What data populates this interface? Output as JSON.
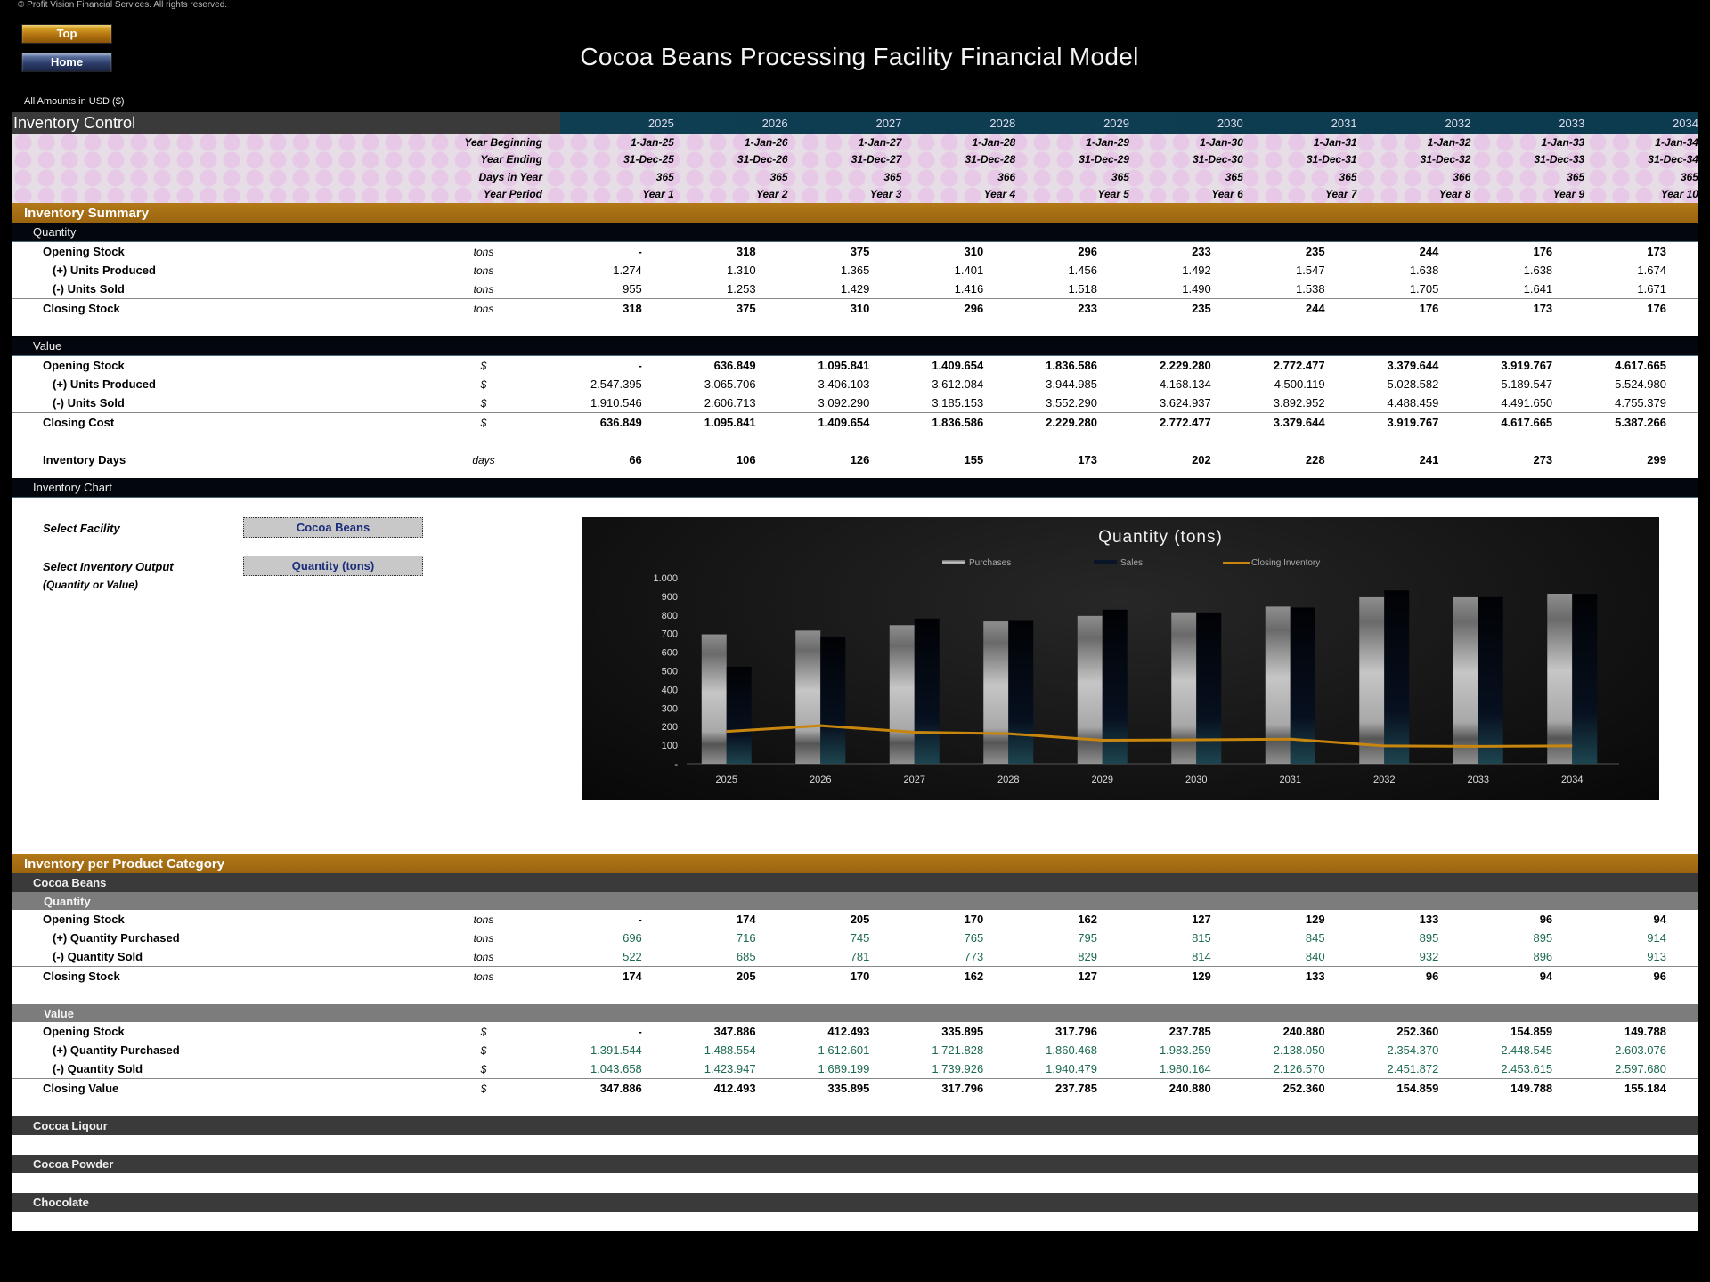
{
  "copyright": "© Profit Vision Financial Services. All rights reserved.",
  "nav": {
    "top_label": "Top",
    "home_label": "Home"
  },
  "title": "Cocoa Beans Processing Facility Financial Model",
  "amounts_note": "All Amounts in  USD ($)",
  "header": {
    "title": "Inventory Control",
    "years": [
      "2025",
      "2026",
      "2027",
      "2028",
      "2029",
      "2030",
      "2031",
      "2032",
      "2033",
      "2034"
    ],
    "rows": [
      {
        "label": "Year Beginning",
        "values": [
          "1-Jan-25",
          "1-Jan-26",
          "1-Jan-27",
          "1-Jan-28",
          "1-Jan-29",
          "1-Jan-30",
          "1-Jan-31",
          "1-Jan-32",
          "1-Jan-33",
          "1-Jan-34"
        ]
      },
      {
        "label": "Year Ending",
        "values": [
          "31-Dec-25",
          "31-Dec-26",
          "31-Dec-27",
          "31-Dec-28",
          "31-Dec-29",
          "31-Dec-30",
          "31-Dec-31",
          "31-Dec-32",
          "31-Dec-33",
          "31-Dec-34"
        ]
      },
      {
        "label": "Days in Year",
        "values": [
          "365",
          "365",
          "365",
          "366",
          "365",
          "365",
          "365",
          "366",
          "365",
          "365"
        ]
      },
      {
        "label": "Year Period",
        "values": [
          "Year 1",
          "Year 2",
          "Year 3",
          "Year 4",
          "Year 5",
          "Year 6",
          "Year 7",
          "Year 8",
          "Year 9",
          "Year 10"
        ]
      }
    ]
  },
  "summary": {
    "title": "Inventory Summary",
    "quantity": {
      "title": "Quantity",
      "rows": [
        {
          "label": "Opening Stock",
          "unit": "tons",
          "values": [
            "-",
            "318",
            "375",
            "310",
            "296",
            "233",
            "235",
            "244",
            "176",
            "173"
          ]
        },
        {
          "label": "(+) Units Produced",
          "unit": "tons",
          "values": [
            "1.274",
            "1.310",
            "1.365",
            "1.401",
            "1.456",
            "1.492",
            "1.547",
            "1.638",
            "1.638",
            "1.674"
          ]
        },
        {
          "label": "(-) Units Sold",
          "unit": "tons",
          "values": [
            "955",
            "1.253",
            "1.429",
            "1.416",
            "1.518",
            "1.490",
            "1.538",
            "1.705",
            "1.641",
            "1.671"
          ]
        },
        {
          "label": "Closing Stock",
          "unit": "tons",
          "values": [
            "318",
            "375",
            "310",
            "296",
            "233",
            "235",
            "244",
            "176",
            "173",
            "176"
          ]
        }
      ]
    },
    "value": {
      "title": "Value",
      "rows": [
        {
          "label": "Opening Stock",
          "unit": "$",
          "values": [
            "-",
            "636.849",
            "1.095.841",
            "1.409.654",
            "1.836.586",
            "2.229.280",
            "2.772.477",
            "3.379.644",
            "3.919.767",
            "4.617.665"
          ]
        },
        {
          "label": "(+) Units Produced",
          "unit": "$",
          "values": [
            "2.547.395",
            "3.065.706",
            "3.406.103",
            "3.612.084",
            "3.944.985",
            "4.168.134",
            "4.500.119",
            "5.028.582",
            "5.189.547",
            "5.524.980"
          ]
        },
        {
          "label": "(-) Units Sold",
          "unit": "$",
          "values": [
            "1.910.546",
            "2.606.713",
            "3.092.290",
            "3.185.153",
            "3.552.290",
            "3.624.937",
            "3.892.952",
            "4.488.459",
            "4.491.650",
            "4.755.379"
          ]
        },
        {
          "label": "Closing Cost",
          "unit": "$",
          "values": [
            "636.849",
            "1.095.841",
            "1.409.654",
            "1.836.586",
            "2.229.280",
            "2.772.477",
            "3.379.644",
            "3.919.767",
            "4.617.665",
            "5.387.266"
          ]
        }
      ]
    },
    "days": {
      "label": "Inventory Days",
      "unit": "days",
      "values": [
        "66",
        "106",
        "126",
        "155",
        "173",
        "202",
        "228",
        "241",
        "273",
        "299"
      ]
    }
  },
  "chart_section": {
    "title": "Inventory Chart",
    "facility_label": "Select Facility",
    "facility_value": "Cocoa Beans",
    "output_label": "Select Inventory Output",
    "output_note": "(Quantity or Value)",
    "output_value": "Quantity (tons)"
  },
  "chart_data": {
    "type": "bar",
    "title": "Quantity (tons)",
    "categories": [
      "2025",
      "2026",
      "2027",
      "2028",
      "2029",
      "2030",
      "2031",
      "2032",
      "2033",
      "2034"
    ],
    "series": [
      {
        "name": "Purchases",
        "type": "bar",
        "values": [
          696,
          716,
          745,
          765,
          795,
          815,
          845,
          895,
          895,
          914
        ]
      },
      {
        "name": "Sales",
        "type": "bar",
        "values": [
          522,
          685,
          781,
          773,
          829,
          814,
          840,
          932,
          896,
          913
        ]
      },
      {
        "name": "Closing Inventory",
        "type": "line",
        "values": [
          174,
          205,
          170,
          162,
          127,
          129,
          133,
          96,
          94,
          96
        ]
      }
    ],
    "ylim": [
      0,
      1000
    ],
    "yticks": [
      "-",
      "100",
      "200",
      "300",
      "400",
      "500",
      "600",
      "700",
      "800",
      "900",
      "1.000"
    ],
    "legend": "top",
    "colors": {
      "purchases": "#b8b8b8",
      "sales": "#06101e",
      "line": "#c8860e"
    }
  },
  "categories": {
    "title": "Inventory per Product Category",
    "items": [
      {
        "name": "Cocoa Beans",
        "quantity_title": "Quantity",
        "quantity_rows": [
          {
            "label": "Opening Stock",
            "unit": "tons",
            "values": [
              "-",
              "174",
              "205",
              "170",
              "162",
              "127",
              "129",
              "133",
              "96",
              "94"
            ]
          },
          {
            "label": "(+) Quantity Purchased",
            "unit": "tons",
            "values": [
              "696",
              "716",
              "745",
              "765",
              "795",
              "815",
              "845",
              "895",
              "895",
              "914"
            ]
          },
          {
            "label": "(-) Quantity Sold",
            "unit": "tons",
            "values": [
              "522",
              "685",
              "781",
              "773",
              "829",
              "814",
              "840",
              "932",
              "896",
              "913"
            ]
          },
          {
            "label": "Closing Stock",
            "unit": "tons",
            "values": [
              "174",
              "205",
              "170",
              "162",
              "127",
              "129",
              "133",
              "96",
              "94",
              "96"
            ]
          }
        ],
        "value_title": "Value",
        "value_rows": [
          {
            "label": "Opening Stock",
            "unit": "$",
            "values": [
              "-",
              "347.886",
              "412.493",
              "335.895",
              "317.796",
              "237.785",
              "240.880",
              "252.360",
              "154.859",
              "149.788"
            ]
          },
          {
            "label": "(+) Quantity Purchased",
            "unit": "$",
            "values": [
              "1.391.544",
              "1.488.554",
              "1.612.601",
              "1.721.828",
              "1.860.468",
              "1.983.259",
              "2.138.050",
              "2.354.370",
              "2.448.545",
              "2.603.076"
            ]
          },
          {
            "label": "(-) Quantity Sold",
            "unit": "$",
            "values": [
              "1.043.658",
              "1.423.947",
              "1.689.199",
              "1.739.926",
              "1.940.479",
              "1.980.164",
              "2.126.570",
              "2.451.872",
              "2.453.615",
              "2.597.680"
            ]
          },
          {
            "label": "Closing Value",
            "unit": "$",
            "values": [
              "347.886",
              "412.493",
              "335.895",
              "317.796",
              "237.785",
              "240.880",
              "252.360",
              "154.859",
              "149.788",
              "155.184"
            ]
          }
        ]
      },
      {
        "name": "Cocoa Liqour"
      },
      {
        "name": "Cocoa Powder"
      },
      {
        "name": "Chocolate"
      }
    ]
  }
}
